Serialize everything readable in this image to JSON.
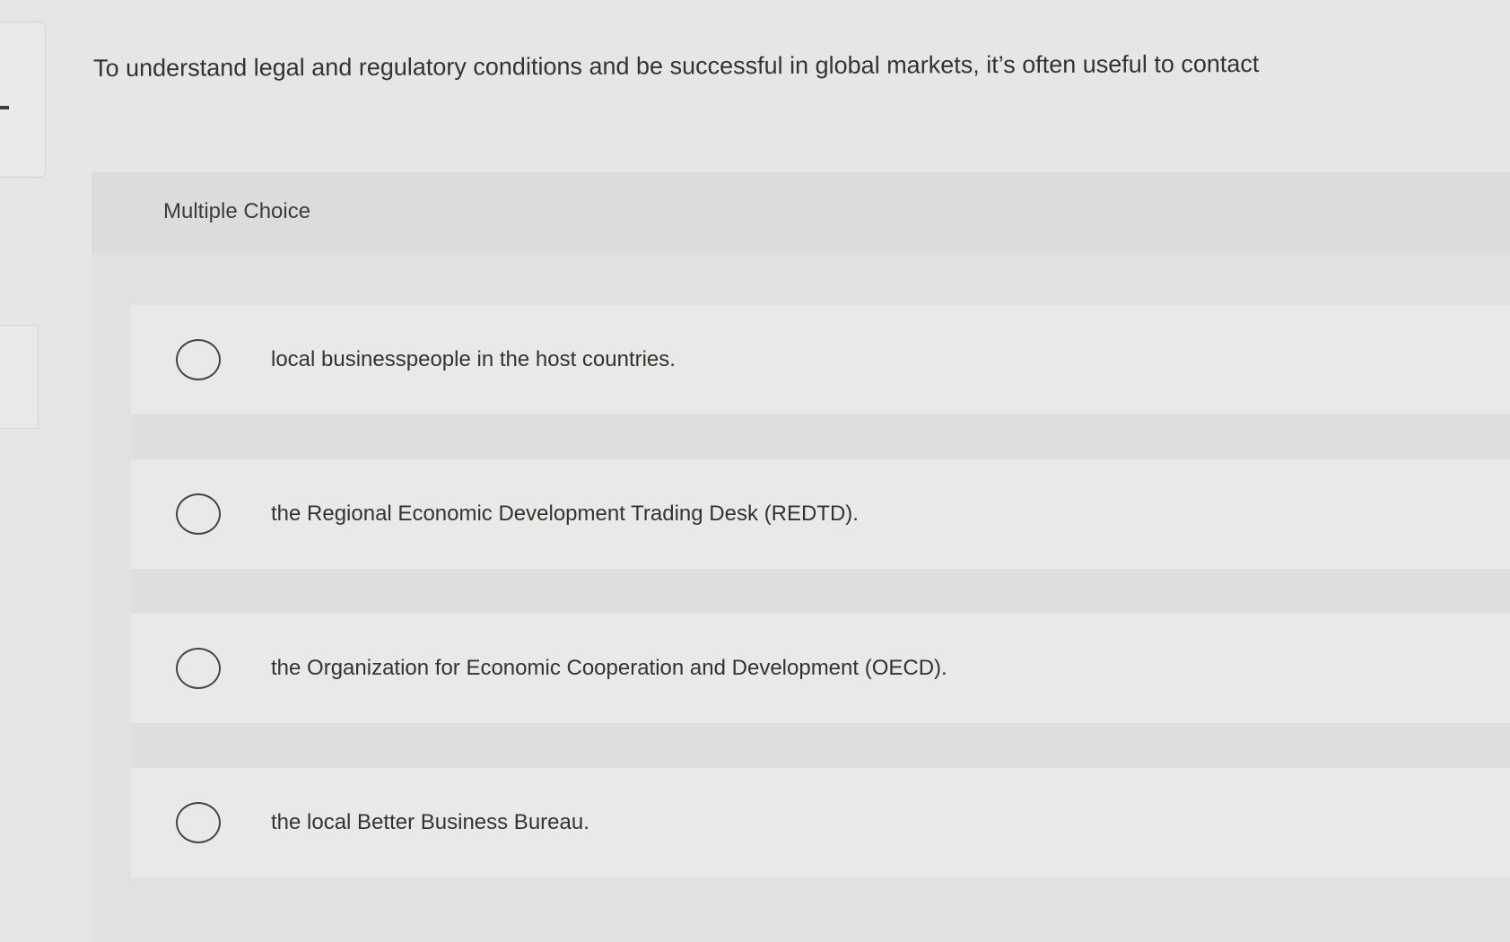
{
  "question": {
    "text": "To understand legal and regulatory conditions and be successful in global markets, it’s often useful to contact"
  },
  "multiple_choice": {
    "label": "Multiple Choice",
    "options": [
      {
        "label": "local businesspeople in the host countries.",
        "selected": false
      },
      {
        "label": "the Regional Economic Development Trading Desk (REDTD).",
        "selected": false
      },
      {
        "label": "the Organization for Economic Cooperation and Development (OECD).",
        "selected": false
      },
      {
        "label": "the local Better Business Bureau.",
        "selected": false
      }
    ]
  },
  "icons": {
    "radio": "radio-circle-icon"
  }
}
